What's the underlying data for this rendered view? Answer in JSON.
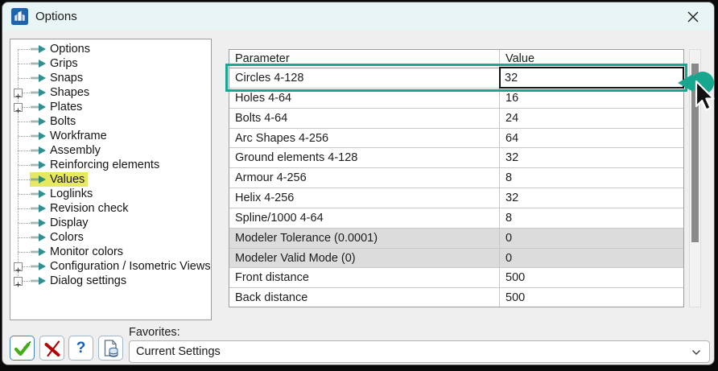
{
  "window": {
    "title": "Options"
  },
  "sidebar": {
    "items": [
      {
        "label": "Options"
      },
      {
        "label": "Grips"
      },
      {
        "label": "Snaps"
      },
      {
        "label": "Shapes",
        "expandable": true
      },
      {
        "label": "Plates",
        "expandable": true
      },
      {
        "label": "Bolts"
      },
      {
        "label": "Workframe"
      },
      {
        "label": "Assembly"
      },
      {
        "label": "Reinforcing elements"
      },
      {
        "label": "Values",
        "selected": true
      },
      {
        "label": "Loglinks"
      },
      {
        "label": "Revision check"
      },
      {
        "label": "Display"
      },
      {
        "label": "Colors"
      },
      {
        "label": "Monitor colors"
      },
      {
        "label": "Configuration / Isometric Views",
        "expandable": true
      },
      {
        "label": "Dialog settings",
        "expandable": true
      }
    ]
  },
  "table": {
    "columns": [
      "Parameter",
      "Value"
    ],
    "rows": [
      {
        "parameter": "Circles 4-128",
        "value": "32",
        "state": "editing"
      },
      {
        "parameter": "Holes 4-64",
        "value": "16"
      },
      {
        "parameter": "Bolts 4-64",
        "value": "24"
      },
      {
        "parameter": "Arc Shapes 4-256",
        "value": "64"
      },
      {
        "parameter": "Ground elements 4-128",
        "value": "32"
      },
      {
        "parameter": "Armour 4-256",
        "value": "8"
      },
      {
        "parameter": "Helix 4-256",
        "value": "32"
      },
      {
        "parameter": "Spline/1000 4-64",
        "value": "8"
      },
      {
        "parameter": "Modeler Tolerance (0.0001)",
        "value": "0",
        "disabled": true
      },
      {
        "parameter": "Modeler Valid Mode (0)",
        "value": "0",
        "disabled": true
      },
      {
        "parameter": "Front distance",
        "value": "500"
      },
      {
        "parameter": "Back distance",
        "value": "500"
      }
    ]
  },
  "footer": {
    "favorites_label": "Favorites:",
    "favorites_value": "Current Settings",
    "help_glyph": "?",
    "buttons": [
      "ok",
      "cancel",
      "help",
      "save-favorites"
    ]
  },
  "icons": {
    "titlebar": "app-logo-icon",
    "close": "x-icon",
    "tree_item": "arrow-right-icon",
    "expand": "plus-box-icon",
    "ok": "green-check-icon",
    "cancel": "red-cross-icon",
    "help": "question-mark-icon",
    "favorites": "document-database-icon",
    "combo": "chevron-down-icon",
    "pointer": "mouse-cursor-with-click-indicator"
  },
  "colors": {
    "accent_teal": "#17a78f",
    "highlight_yellow": "#e5e860",
    "titlebar_bg": "#e9f4f5",
    "disabled_row_bg": "#dcdcdc",
    "app_icon_blue": "#1e63ad"
  }
}
